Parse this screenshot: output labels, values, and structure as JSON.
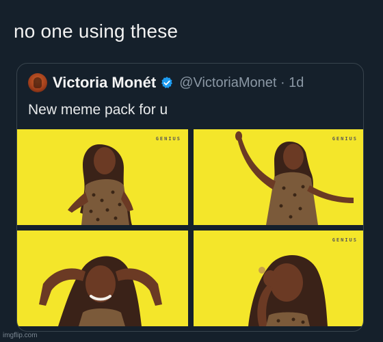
{
  "caption": "no one using these",
  "quoted_tweet": {
    "name": "Victoria Monét",
    "handle_time": "@VictoriaMonet · 1d",
    "text": "New meme pack for u",
    "panels": [
      {
        "brand": "GENIUS"
      },
      {
        "brand": "GENIUS"
      },
      {
        "brand": ""
      },
      {
        "brand": "GENIUS"
      }
    ]
  },
  "watermark": "imgflip.com",
  "colors": {
    "background": "#15202b",
    "panel_yellow": "#f4e62a",
    "verified_blue": "#1d9bf0",
    "muted_text": "#8b98a5"
  },
  "icons": {
    "verified": "verified-badge-icon",
    "avatar": "profile-avatar"
  }
}
